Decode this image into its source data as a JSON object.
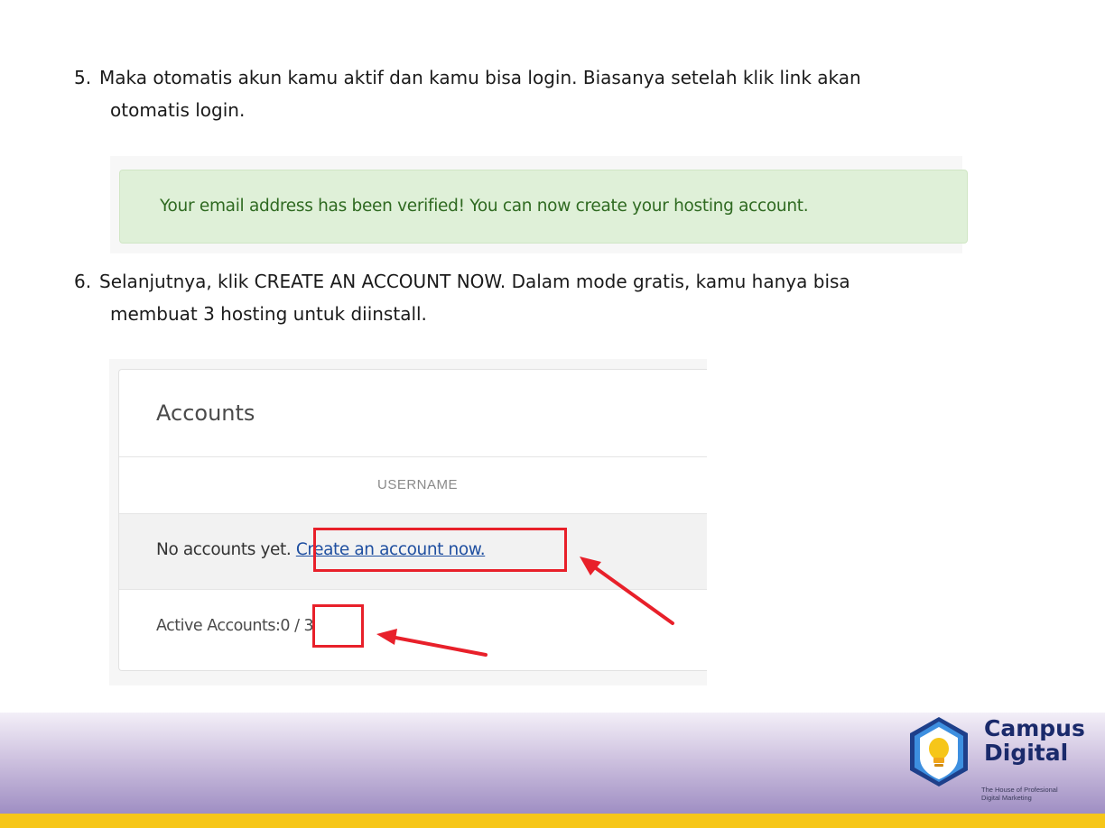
{
  "steps": [
    {
      "number": "5.",
      "line1": "Maka otomatis akun kamu aktif dan kamu bisa login. Biasanya setelah klik link akan",
      "line2": "otomatis login."
    },
    {
      "number": "6.",
      "line1": "Selanjutnya, klik CREATE AN ACCOUNT NOW. Dalam mode gratis, kamu hanya bisa",
      "line2": "membuat 3 hosting untuk diinstall."
    }
  ],
  "alert": {
    "message": "Your email address has been verified! You can now create your hosting account."
  },
  "accounts_panel": {
    "title": "Accounts",
    "column_header": "USERNAME",
    "empty_text": "No accounts yet.",
    "create_link": "Create an account now.",
    "active_label": "Active Accounts:",
    "active_value": "0 / 3"
  },
  "logo": {
    "line1": "Campus",
    "line2": "Digital",
    "tagline1": "The House of Profesional",
    "tagline2": "Digital Marketing"
  },
  "colors": {
    "highlight": "#e8202a",
    "footer_bar": "#f6c619",
    "brand_blue": "#1a2a6b"
  }
}
